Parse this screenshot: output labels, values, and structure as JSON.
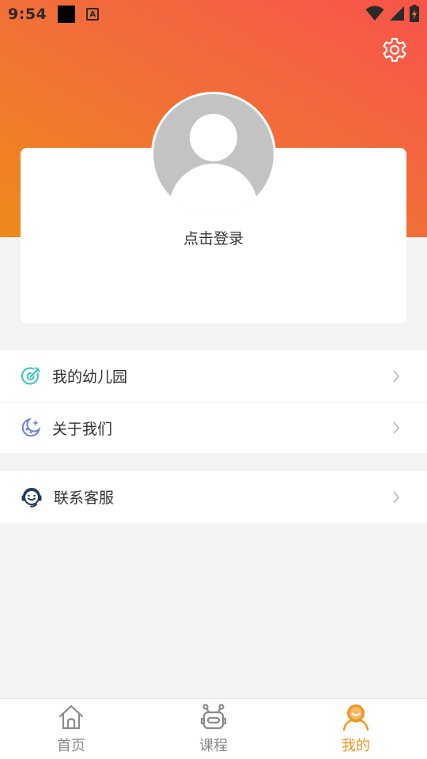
{
  "status_bar": {
    "time": "9:54",
    "notification_icons": [
      "black-square-icon",
      "a-badge-icon"
    ],
    "system_icons": [
      "wifi-icon",
      "signal-icon",
      "battery-charging-icon"
    ]
  },
  "header": {
    "gradient_colors": [
      "#ee8a1a",
      "#f7544a"
    ],
    "settings_icon": "gear-icon"
  },
  "profile": {
    "login_prompt": "点击登录",
    "avatar_icon": "default-avatar-icon"
  },
  "menu_group_1": [
    {
      "label": "我的幼儿园",
      "icon": "target-icon",
      "icon_color": "#2fc3c3"
    },
    {
      "label": "关于我们",
      "icon": "moon-icon",
      "icon_color": "#6e7fd8"
    }
  ],
  "menu_group_2": [
    {
      "label": "联系客服",
      "icon": "headset-icon",
      "icon_color": "#1e3a5a"
    }
  ],
  "bottom_nav": {
    "active_color": "#f0941e",
    "tabs": [
      {
        "label": "首页",
        "icon": "home-icon",
        "active": false
      },
      {
        "label": "课程",
        "icon": "robot-icon",
        "active": false
      },
      {
        "label": "我的",
        "icon": "profile-icon",
        "active": true
      }
    ]
  }
}
